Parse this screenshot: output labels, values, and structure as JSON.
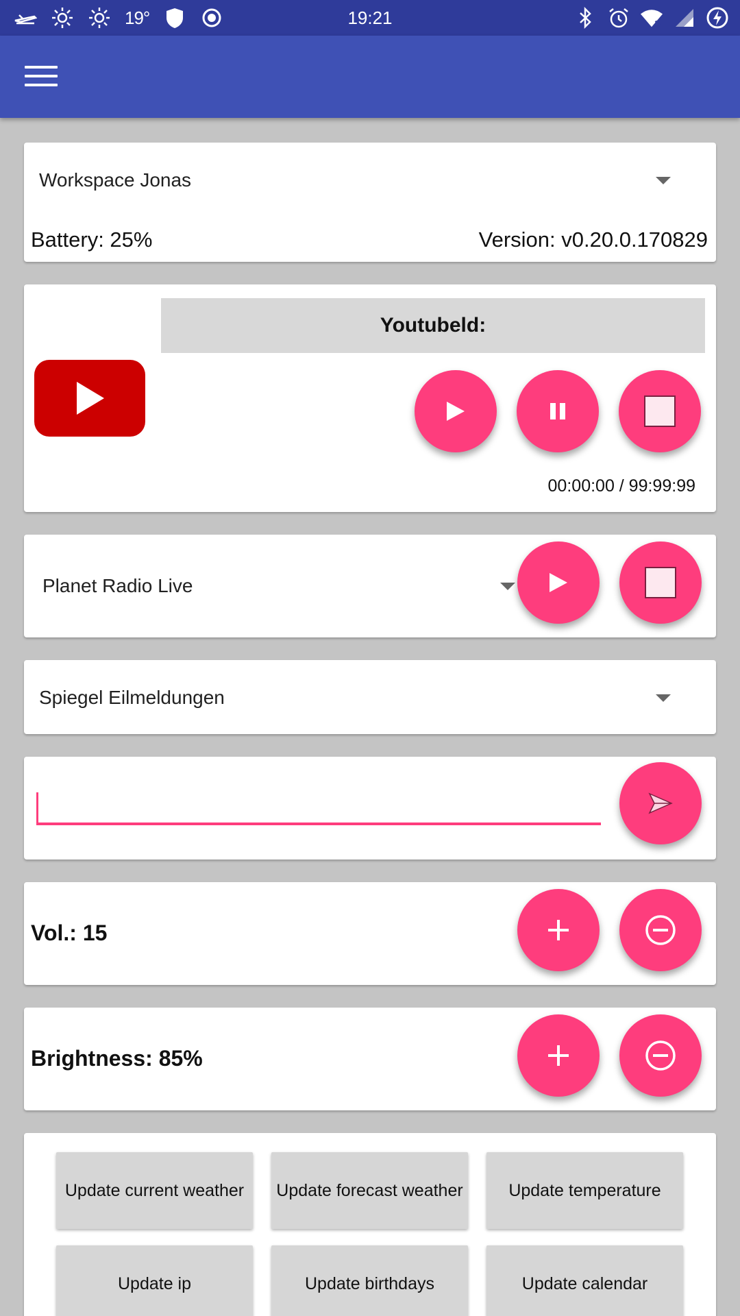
{
  "status_bar": {
    "temperature": "19°",
    "time": "19:21",
    "icons_left": [
      "airplane-notification-icon",
      "sun-icon",
      "sun-icon",
      "shield-icon",
      "record-icon"
    ],
    "icons_right": [
      "bluetooth-icon",
      "alarm-icon",
      "wifi-off-icon",
      "signal-icon",
      "battery-charging-icon"
    ]
  },
  "workspace": {
    "selected": "Workspace Jonas",
    "battery": "Battery: 25%",
    "version": "Version: v0.20.0.170829"
  },
  "youtube": {
    "header": "Youtubeld:",
    "time": "00:00:00 / 99:99:99"
  },
  "radio": {
    "selected": "Planet Radio Live"
  },
  "news": {
    "selected": "Spiegel Eilmeldungen"
  },
  "message": {
    "value": ""
  },
  "volume": {
    "label": "Vol.: 15"
  },
  "brightness": {
    "label": "Brightness: 85%"
  },
  "updates": {
    "buttons": [
      "Update current weather",
      "Update forecast weather",
      "Update temperature",
      "Update ip",
      "Update birthdays",
      "Update calendar"
    ]
  },
  "colors": {
    "status_bar": "#2f3b9a",
    "app_bar": "#3f51b5",
    "accent": "#fe3d7d",
    "youtube_red": "#cc0000",
    "background": "#c4c4c4"
  }
}
